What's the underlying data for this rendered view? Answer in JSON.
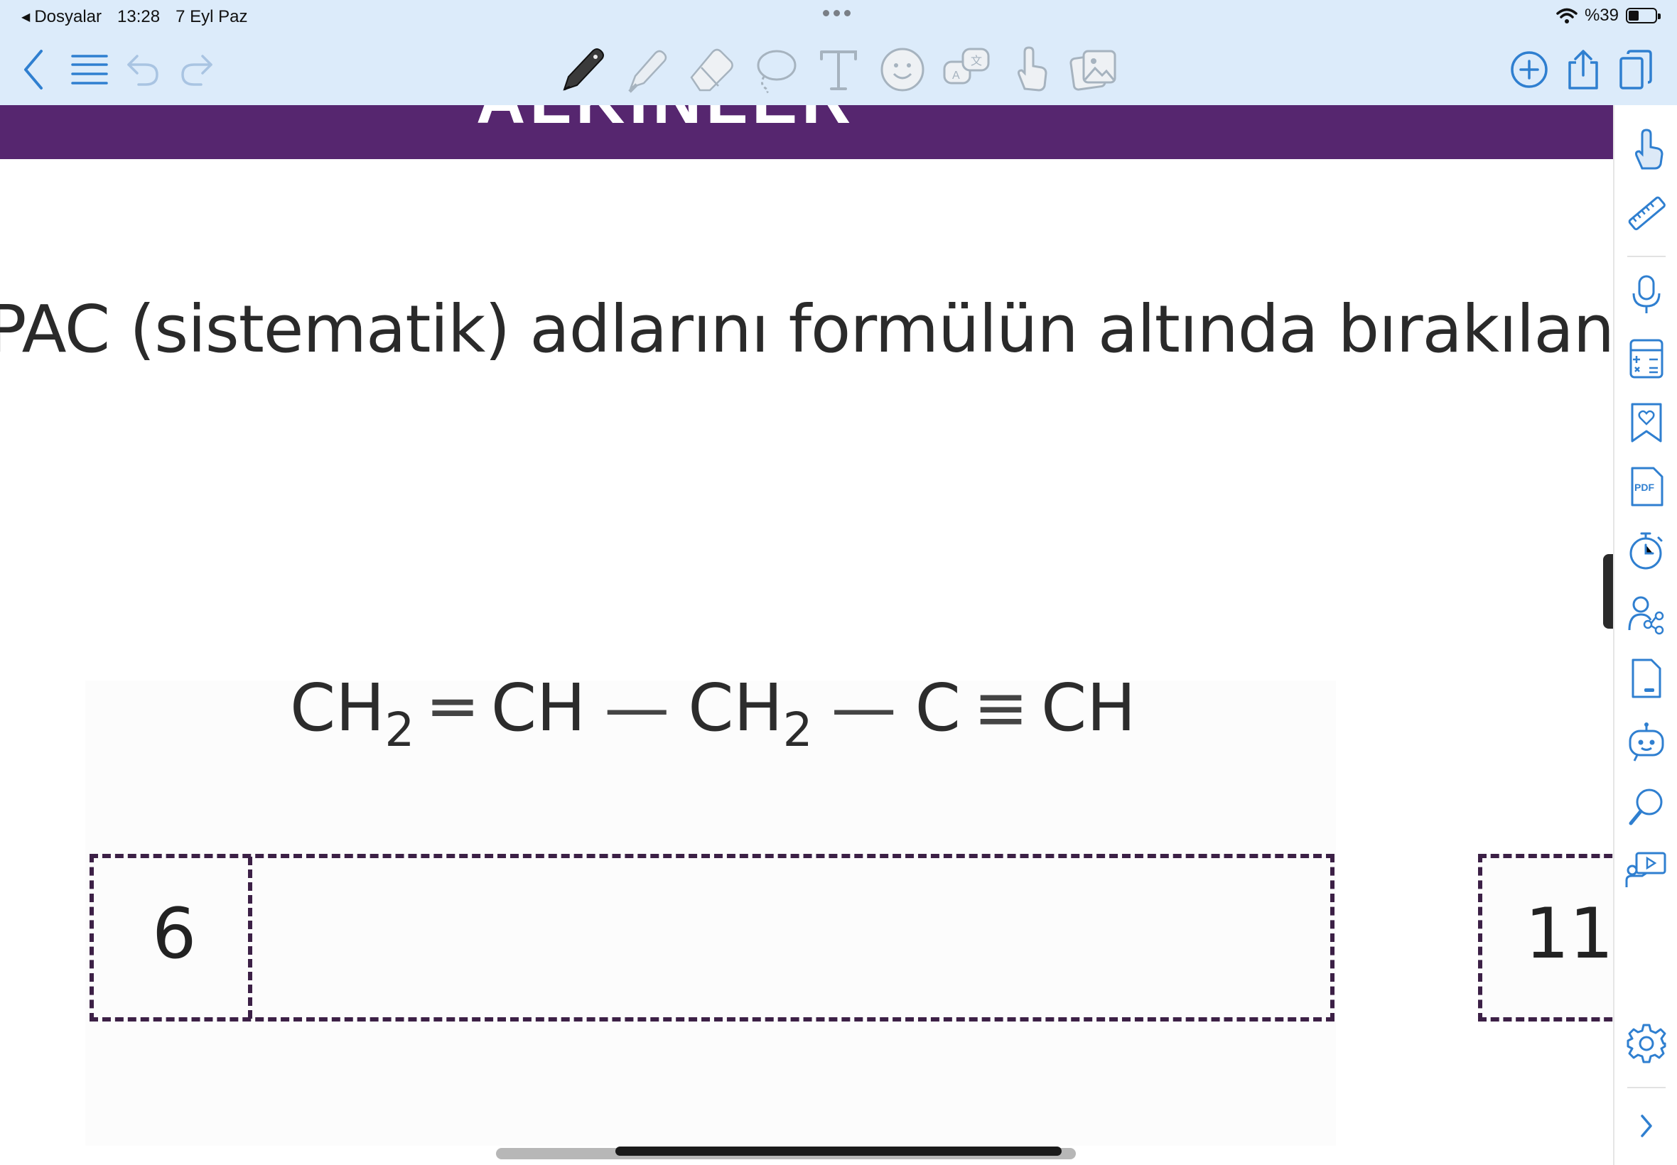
{
  "status_bar": {
    "back_app": "Dosyalar",
    "time": "13:28",
    "date": "7 Eyl Paz",
    "battery": "%39",
    "battery_level": 0.39
  },
  "toolbar": {
    "left_icons": [
      "back-icon",
      "menu-icon",
      "undo-icon",
      "redo-icon"
    ],
    "tools": [
      "pen-icon",
      "highlighter-icon",
      "eraser-icon",
      "lasso-icon",
      "text-icon",
      "sticker-icon",
      "translate-icon",
      "hand-pointer-icon",
      "image-icon"
    ],
    "right_icons": [
      "add-page-icon",
      "share-icon",
      "pages-icon"
    ],
    "accent": "#2f7fd0"
  },
  "document": {
    "banner_title": "ALKINLER",
    "banner_color": "#56266f",
    "instruction": "PAC (sistematik) adlarını formülün altında bırakılan",
    "formula": {
      "p1": "CH",
      "s1": "2",
      "b1": "═",
      "p2": "CH",
      "b2": "—",
      "p3": "CH",
      "s3": "2",
      "b3": "—",
      "p4": "C",
      "b4": "≡",
      "p5": "CH"
    },
    "question_numbers": [
      "6",
      "11"
    ]
  },
  "sidebar": {
    "icons": [
      "hand-pointer-icon",
      "ruler-icon",
      "microphone-icon",
      "calculator-icon",
      "bookmark-heart-icon",
      "pdf-icon",
      "timer-icon",
      "share-people-icon",
      "page-icon",
      "robot-assistant-icon",
      "search-icon",
      "presentation-icon",
      "settings-icon",
      "chevron-right-icon"
    ],
    "pdf_label": "PDF"
  }
}
